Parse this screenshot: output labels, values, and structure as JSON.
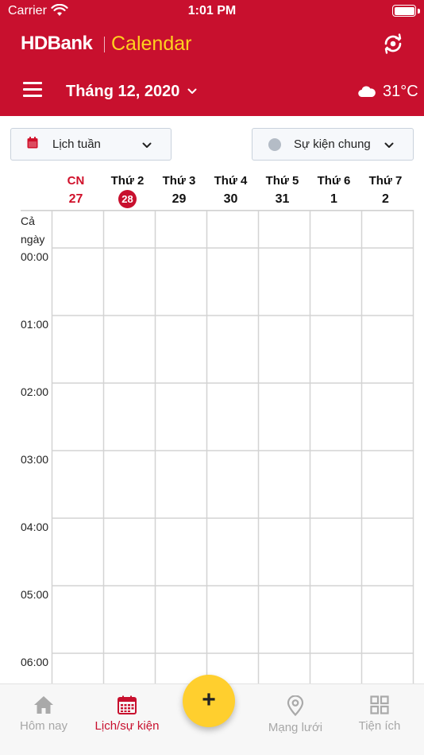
{
  "status_bar": {
    "carrier": "Carrier",
    "time": "1:01 PM"
  },
  "header": {
    "brand": "HDBank",
    "app_name": "Calendar",
    "month_title": "Tháng 12, 2020",
    "weather_temp": "31°C",
    "colors": {
      "primary": "#c8102e",
      "accent": "#ffd21e"
    }
  },
  "filters": {
    "view": {
      "label": "Lịch tuần",
      "icon": "calendar-icon"
    },
    "event": {
      "label": "Sự kiện chung",
      "icon": "dot-icon"
    }
  },
  "days": [
    {
      "name": "CN",
      "num": "27",
      "sunday": true,
      "today": false
    },
    {
      "name": "Thứ 2",
      "num": "28",
      "sunday": false,
      "today": true
    },
    {
      "name": "Thứ 3",
      "num": "29",
      "sunday": false,
      "today": false
    },
    {
      "name": "Thứ 4",
      "num": "30",
      "sunday": false,
      "today": false
    },
    {
      "name": "Thứ 5",
      "num": "31",
      "sunday": false,
      "today": false
    },
    {
      "name": "Thứ 6",
      "num": "1",
      "sunday": false,
      "today": false
    },
    {
      "name": "Thứ 7",
      "num": "2",
      "sunday": false,
      "today": false
    }
  ],
  "grid": {
    "allday_label": "Cả ngày",
    "hours": [
      "00:00",
      "01:00",
      "02:00",
      "03:00",
      "04:00",
      "05:00",
      "06:00"
    ]
  },
  "bottom_nav": {
    "items": [
      {
        "label": "Hôm nay",
        "icon": "home-icon",
        "active": false
      },
      {
        "label": "Lịch/sự kiện",
        "icon": "calendar-icon",
        "active": true
      },
      {
        "label": "Mạng lưới",
        "icon": "location-pin-icon",
        "active": false
      },
      {
        "label": "Tiện ích",
        "icon": "grid-icon",
        "active": false
      }
    ],
    "fab_label": "+"
  }
}
